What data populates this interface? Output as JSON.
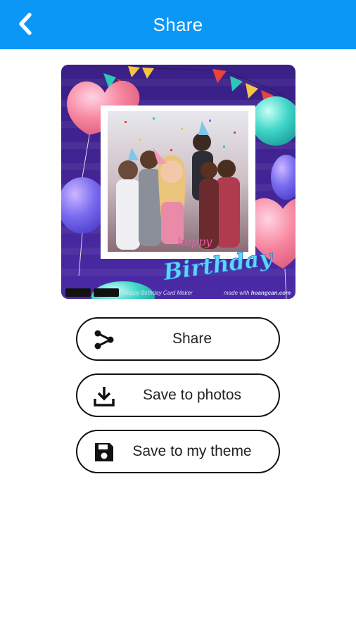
{
  "appbar": {
    "title": "Share",
    "back_icon": "chevron-left-icon",
    "background": "#0b97f5"
  },
  "card": {
    "script_text_1": "happy",
    "script_text_2": "Birthday",
    "footer_left": "Happy Birthday Card Maker",
    "footer_right": "made with",
    "footer_brand": "hoangcan.com"
  },
  "actions": [
    {
      "label": "Share",
      "icon": "share-icon"
    },
    {
      "label": "Save to photos",
      "icon": "download-icon"
    },
    {
      "label": "Save to my theme",
      "icon": "save-disk-icon"
    }
  ]
}
